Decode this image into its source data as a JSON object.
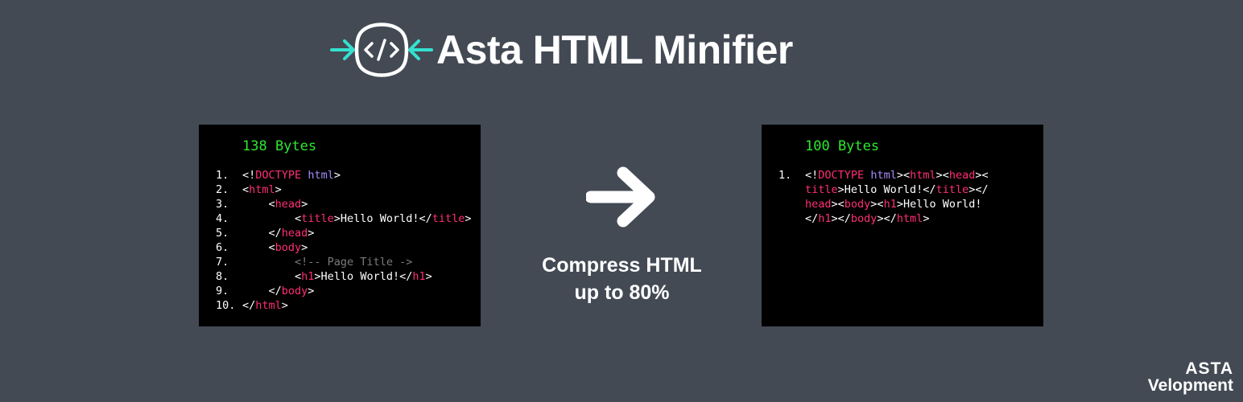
{
  "header": {
    "title": "Asta HTML Minifier",
    "logo_icon": "code-compress-icon",
    "accent_color": "#35e0d0"
  },
  "left_panel": {
    "bytes_label": "138 Bytes",
    "lines": [
      {
        "num": "1.",
        "html": "&lt;!<span class=\"kw\">DOCTYPE</span> <span class=\"attr\">html</span>&gt;"
      },
      {
        "num": "2.",
        "html": "&lt;<span class=\"tag\">html</span>&gt;"
      },
      {
        "num": "3.",
        "html": "    &lt;<span class=\"tag\">head</span>&gt;"
      },
      {
        "num": "4.",
        "html": "        &lt;<span class=\"tag\">title</span>&gt;Hello World!&lt;/<span class=\"tag\">title</span>&gt;"
      },
      {
        "num": "5.",
        "html": "    &lt;/<span class=\"tag\">head</span>&gt;"
      },
      {
        "num": "6.",
        "html": "    &lt;<span class=\"tag\">body</span>&gt;"
      },
      {
        "num": "7.",
        "html": "        <span class=\"cmt\">&lt;!-- Page Title -&gt;</span>"
      },
      {
        "num": "8.",
        "html": "        &lt;<span class=\"tag\">h1</span>&gt;Hello World!&lt;/<span class=\"tag\">h1</span>&gt;"
      },
      {
        "num": "9.",
        "html": "    &lt;/<span class=\"tag\">body</span>&gt;"
      },
      {
        "num": "10.",
        "html": "&lt;/<span class=\"tag\">html</span>&gt;"
      }
    ]
  },
  "middle": {
    "arrow_icon": "arrow-right-icon",
    "tagline_line1": "Compress HTML",
    "tagline_line2": "up to 80%"
  },
  "right_panel": {
    "bytes_label": "100 Bytes",
    "lines": [
      {
        "num": "1.",
        "html": "&lt;!<span class=\"kw\">DOCTYPE</span> <span class=\"attr\">html</span>&gt;&lt;<span class=\"tag\">html</span>&gt;&lt;<span class=\"tag\">head</span>&gt;&lt;"
      },
      {
        "num": "",
        "html": "<span class=\"tag\">title</span>&gt;Hello World!&lt;/<span class=\"tag\">title</span>&gt;&lt;/"
      },
      {
        "num": "",
        "html": "<span class=\"tag\">head</span>&gt;&lt;<span class=\"tag\">body</span>&gt;&lt;<span class=\"tag\">h1</span>&gt;Hello World!"
      },
      {
        "num": "",
        "html": "&lt;/<span class=\"tag\">h1</span>&gt;&lt;/<span class=\"tag\">body</span>&gt;&lt;/<span class=\"tag\">html</span>&gt;"
      }
    ]
  },
  "brand": {
    "line1": "ASTA",
    "line2": "Velopment"
  }
}
